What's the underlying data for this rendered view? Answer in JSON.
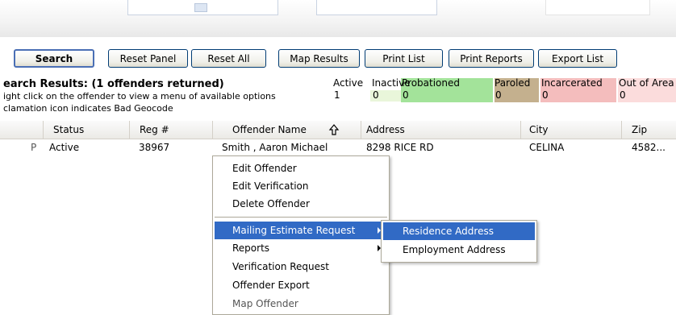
{
  "toolbar": {
    "search": "Search",
    "reset_panel": "Reset Panel",
    "reset_all": "Reset All",
    "map_results": "Map Results",
    "print_list": "Print List",
    "print_reports": "Print Reports",
    "export_list": "Export List"
  },
  "results": {
    "title": "earch Results: (1 offenders returned)",
    "hint1": "ight click on the offender to view a menu of available options",
    "hint2": "clamation icon indicates Bad Geocode"
  },
  "status_counts": [
    {
      "label": "Active",
      "count": "1",
      "color": "#ffffff"
    },
    {
      "label": "Inactive",
      "count": "0",
      "color": "#e9f6da"
    },
    {
      "label": "Probationed",
      "count": "0",
      "color": "#a3e39a"
    },
    {
      "label": "Paroled",
      "count": "0",
      "color": "#c4b08e"
    },
    {
      "label": "Incarcerated",
      "count": "0",
      "color": "#f4bdbd"
    },
    {
      "label": "Out of Area",
      "count": "0",
      "color": "#fbdcdc"
    }
  ],
  "grid": {
    "columns": [
      "Status",
      "Reg #",
      "Offender Name",
      "Address",
      "City",
      "Zip"
    ],
    "rows": [
      {
        "flag": "P",
        "status": "Active",
        "reg": "38967",
        "name": "Smith , Aaron Michael",
        "address": "8298 RICE RD",
        "city": "CELINA",
        "zip": "4582..."
      }
    ],
    "sort_icon": "sort-up-arrow-icon"
  },
  "context_menu": {
    "items": [
      {
        "label": "Edit Offender"
      },
      {
        "label": "Edit Verification"
      },
      {
        "label": "Delete Offender"
      },
      {
        "label": "Mailing Estimate Request",
        "submenu": true,
        "highlighted": true
      },
      {
        "label": "Reports",
        "submenu": true
      },
      {
        "label": "Verification Request"
      },
      {
        "label": "Offender Export"
      },
      {
        "label": "Map Offender"
      }
    ],
    "highlight_color": "#316ac5"
  },
  "submenu": {
    "items": [
      {
        "label": "Residence Address",
        "highlighted": true
      },
      {
        "label": "Employment Address"
      }
    ]
  }
}
